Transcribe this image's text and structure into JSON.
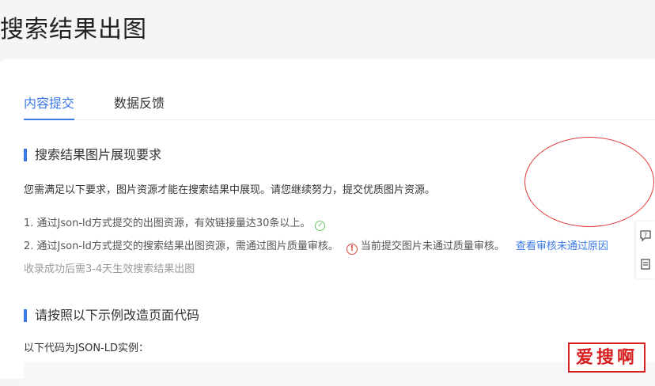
{
  "page": {
    "title": "搜索结果出图"
  },
  "tabs": [
    {
      "label": "内容提交",
      "active": true
    },
    {
      "label": "数据反馈",
      "active": false
    }
  ],
  "requirements": {
    "title": "搜索结果图片展现要求",
    "intro": "您需满足以下要求，图片资源才能在搜索结果中展现。请您继续努力，提交优质图片资源。",
    "item1": "1. 通过Json-ld方式提交的出图资源，有效链接量达30条以上。",
    "item1_status": "passed",
    "item2": "2. 通过Json-ld方式提交的搜索结果出图资源，需通过图片质量审核。",
    "item2_warning": "当前提交图片未通过质量审核。",
    "item2_link": "查看审核未通过原因",
    "note": "收录成功后需3-4天生效搜索结果出图"
  },
  "example": {
    "title": "请按照以下示例改造页面代码",
    "intro": "以下代码为JSON-LD实例："
  },
  "side_tools": [
    {
      "icon": "feedback-question-icon"
    },
    {
      "icon": "document-icon"
    }
  ],
  "watermark": {
    "text": "爱搜啊"
  },
  "colors": {
    "accent": "#3b7ae8",
    "warning": "#e5483f",
    "success": "#6cc46c",
    "annotation": "#e03a3a"
  }
}
